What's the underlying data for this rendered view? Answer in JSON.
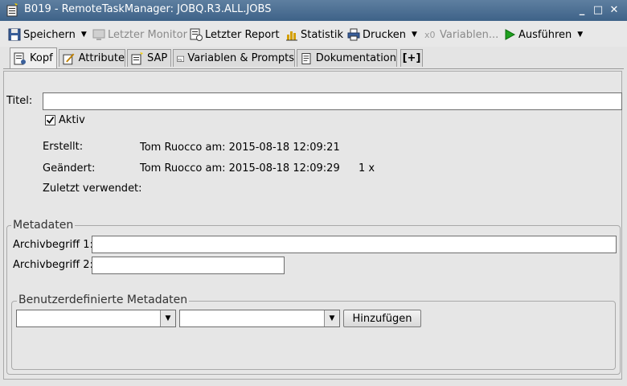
{
  "window": {
    "title": "B019 - RemoteTaskManager: JOBQ.R3.ALL.JOBS",
    "minimize_glyph": "_",
    "maximize_glyph": "□",
    "close_glyph": "✕"
  },
  "toolbar": {
    "save_label": "Speichern",
    "last_monitor_label": "Letzter Monitor",
    "last_report_label": "Letzter Report",
    "statistics_label": "Statistik",
    "print_label": "Drucken",
    "variables_label": "Variablen...",
    "execute_label": "Ausführen"
  },
  "tabs": [
    {
      "label": "Kopf",
      "icon": "header-icon"
    },
    {
      "label": "Attribute",
      "icon": "attribute-icon"
    },
    {
      "label": "SAP",
      "icon": "sap-icon"
    },
    {
      "label": "Variablen & Prompts",
      "icon": "variables-icon"
    },
    {
      "label": "Dokumentation",
      "icon": "documentation-icon"
    },
    {
      "label": "[+]",
      "icon": "add-tab-icon"
    }
  ],
  "form": {
    "title_label": "Titel:",
    "title_value": "",
    "active_label": "Aktiv",
    "active_checked": true,
    "created_label": "Erstellt:",
    "created_value": "Tom Ruocco am: 2015-08-18 12:09:21",
    "changed_label": "Geändert:",
    "changed_value": "Tom Ruocco am: 2015-08-18 12:09:29",
    "changed_count": "1 x",
    "last_used_label": "Zuletzt verwendet:",
    "last_used_value": ""
  },
  "metadata": {
    "legend": "Metadaten",
    "archive1_label": "Archivbegriff 1:",
    "archive1_value": "",
    "archive2_label": "Archivbegriff 2:",
    "archive2_value": "",
    "custom": {
      "legend": "Benutzerdefinierte Metadaten",
      "combo1_value": "",
      "combo2_value": "",
      "add_label": "Hinzufügen"
    }
  }
}
